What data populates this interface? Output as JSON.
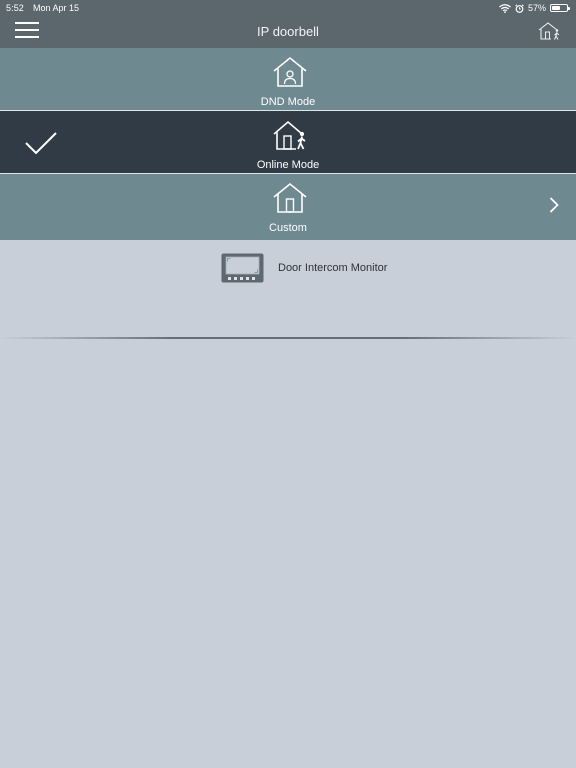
{
  "status_bar": {
    "time": "5:52",
    "date": "Mon Apr 15",
    "battery": "57%",
    "battery_level": 0.57,
    "icons": [
      "wifi-icon",
      "alarm-icon",
      "battery-icon"
    ]
  },
  "header": {
    "title": "IP doorbell",
    "left_icon": "hamburger-menu-icon",
    "right_icon": "home-online-status-icon"
  },
  "modes": [
    {
      "label": "DND Mode",
      "icon": "house-person-icon",
      "selected": false
    },
    {
      "label": "Online Mode",
      "icon": "house-walking-person-icon",
      "selected": true
    },
    {
      "label": "Custom",
      "icon": "house-door-icon",
      "selected": false,
      "has_chevron": true
    }
  ],
  "devices": [
    {
      "label": "Door Intercom Monitor",
      "icon": "intercom-monitor-icon"
    }
  ],
  "colors": {
    "header_bg": "#5c666d",
    "mode_bg": "#6f8990",
    "selected_mode_bg": "#303b46",
    "content_bg": "#c8cfd8",
    "text_light": "#ffffff",
    "text_dark": "#2d3338"
  }
}
